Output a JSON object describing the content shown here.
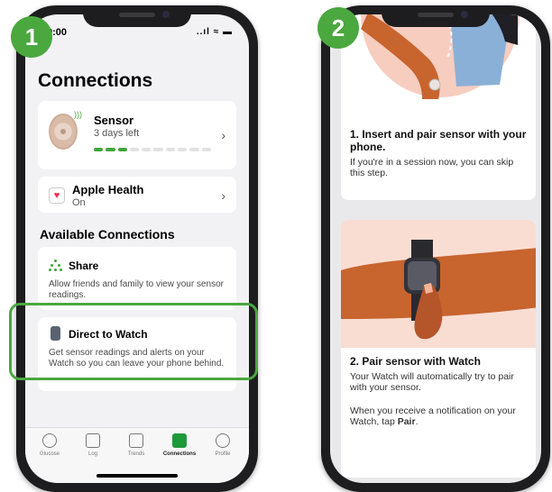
{
  "badges": {
    "step1": "1",
    "step2": "2"
  },
  "screen1": {
    "status_time": "9:00",
    "status_icons": "..ıl ≈ ▬",
    "title": "Connections",
    "sensor": {
      "name": "Sensor",
      "sub": "3 days left",
      "progress_fraction": 0.3
    },
    "apple_health": {
      "name": "Apple Health",
      "sub": "On"
    },
    "section_title": "Available Connections",
    "share": {
      "name": "Share",
      "desc": "Allow friends and family to view your sensor readings."
    },
    "direct_to_watch": {
      "name": "Direct to Watch",
      "desc": "Get sensor readings and alerts on your Watch so you can leave your phone behind."
    },
    "chevron": "›",
    "tabs": [
      {
        "label": "Glucose",
        "icon": "glucose-icon"
      },
      {
        "label": "Log",
        "icon": "log-icon"
      },
      {
        "label": "Trends",
        "icon": "trends-icon"
      },
      {
        "label": "Connections",
        "icon": "connections-icon",
        "active": true
      },
      {
        "label": "Profile",
        "icon": "profile-icon"
      }
    ]
  },
  "screen2": {
    "step1_title": "1. Insert and pair sensor with your phone.",
    "step1_text": "If you're in a session now, you can skip this step.",
    "step2_title": "2. Pair sensor with Watch",
    "step2_text1": "Your Watch will automatically try to pair with your sensor.",
    "step2_text2_prefix": "When you receive a notification on your Watch, tap ",
    "step2_text2_bold": "Pair",
    "step2_text2_suffix": "."
  },
  "colors": {
    "accent_green": "#4aa83f",
    "progress_green": "#3fa63a",
    "heart": "#ff2d55",
    "skin": "#c8642e",
    "shirt": "#8bb0d8"
  }
}
